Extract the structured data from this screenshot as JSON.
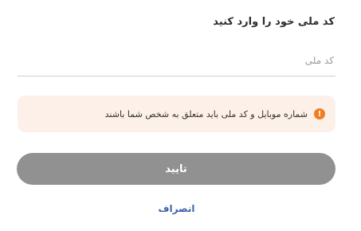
{
  "form": {
    "title": "کد ملی خود را وارد کنید",
    "national_code_value": "",
    "national_code_placeholder": "کد ملی"
  },
  "notice": {
    "icon": "exclamation-icon",
    "icon_glyph": "!",
    "text": "شماره موبایل و کد ملی باید متعلق به شخص شما باشند",
    "background": "#fdf0e8",
    "icon_color": "#ef7d22"
  },
  "actions": {
    "confirm_label": "تایید",
    "cancel_label": "انصراف",
    "confirm_color": "#919191",
    "cancel_color": "#3f64a8"
  }
}
